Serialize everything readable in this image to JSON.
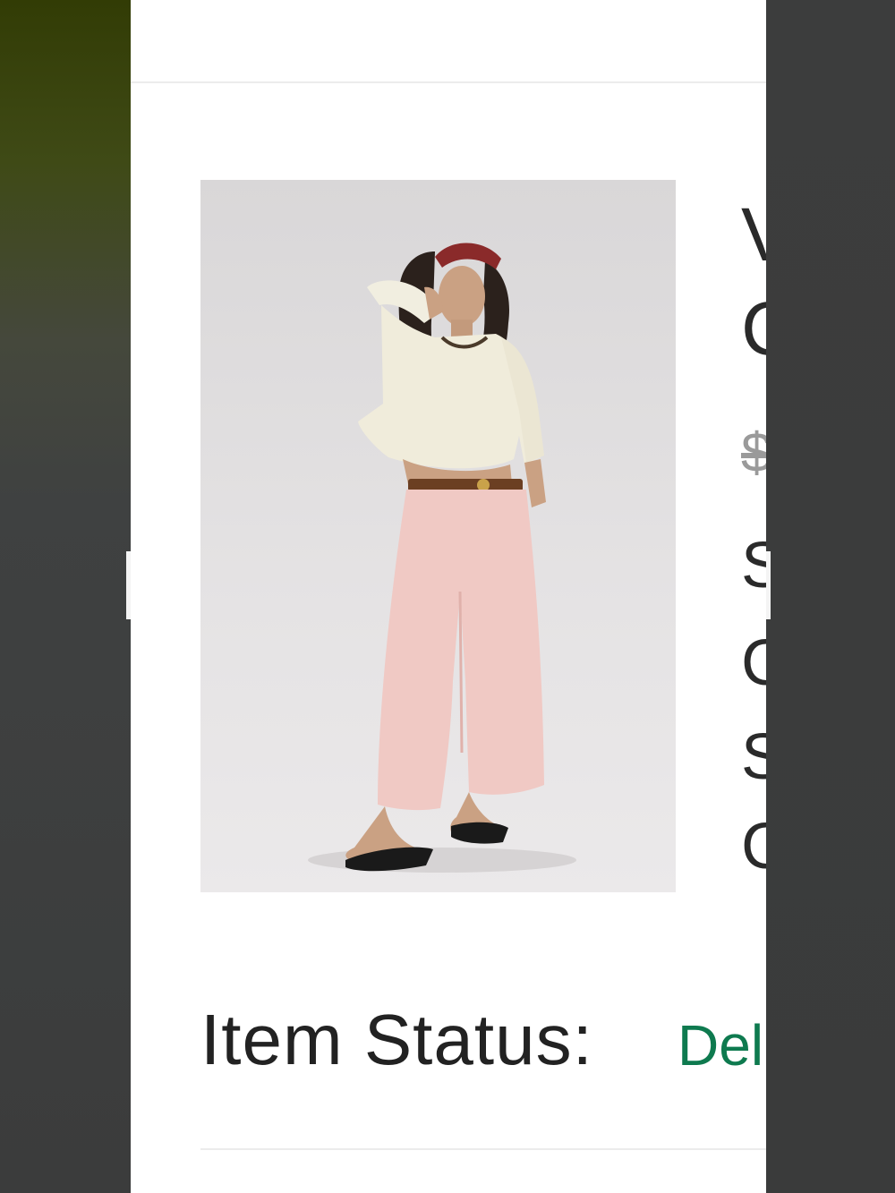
{
  "product": {
    "image_alt": "Woman in cream knit sweater and light pink wide-leg pants with flip-flops",
    "title_line_1": "V",
    "title_line_2": "C",
    "original_price": "$",
    "detail_lines": [
      "S",
      "C",
      "S",
      "C"
    ]
  },
  "status": {
    "label": "Item Status:",
    "value": "Del",
    "value_color": "#0e7a4f"
  }
}
